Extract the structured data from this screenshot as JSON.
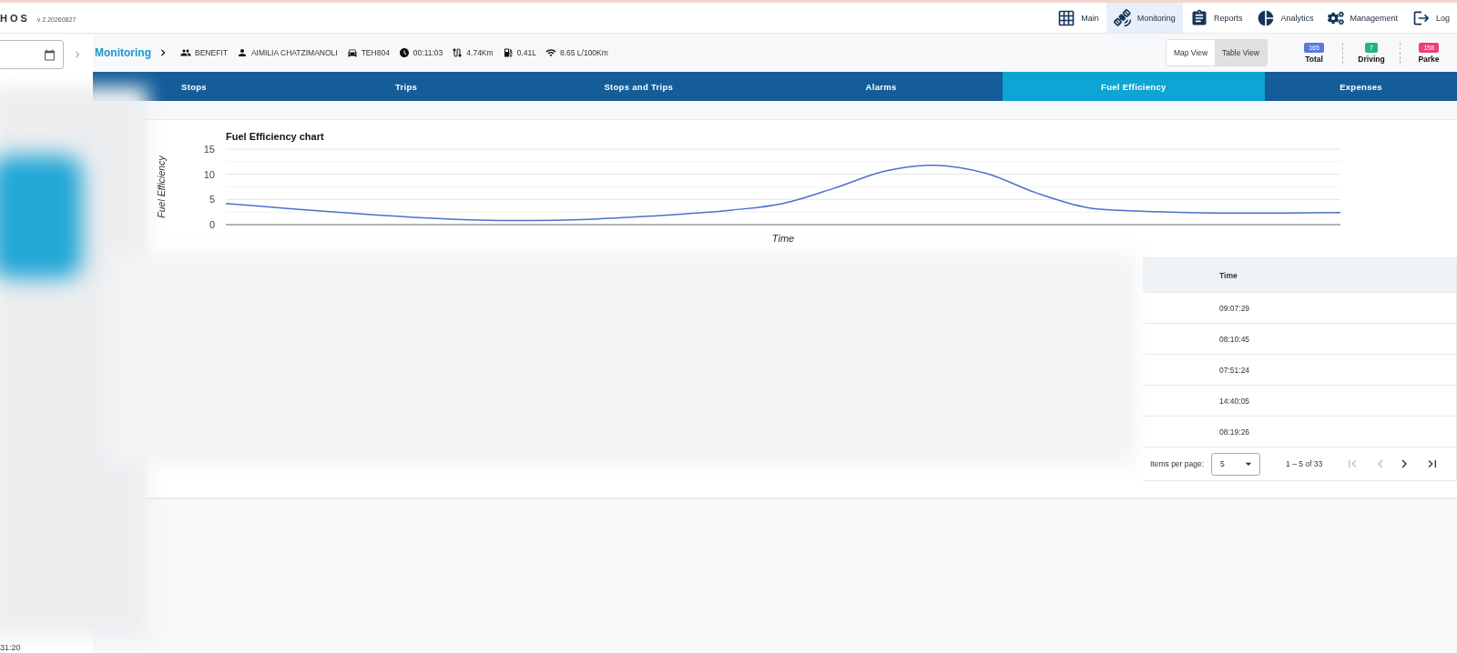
{
  "app": {
    "logo": "HOS",
    "version": "v 2.20260827"
  },
  "nav": [
    {
      "label": "Main",
      "selected": false
    },
    {
      "label": "Monitoring",
      "selected": true
    },
    {
      "label": "Reports",
      "selected": false
    },
    {
      "label": "Analytics",
      "selected": false
    },
    {
      "label": "Management",
      "selected": false
    },
    {
      "label": "Log",
      "selected": false
    }
  ],
  "sidebar": {
    "footer_time": "31:20"
  },
  "breadcrumb": {
    "title": "Monitoring",
    "items": [
      "BENEFIT",
      "AIMILIA CHATZIMANOLI",
      "TEH804",
      "00:11:03",
      "4.74Km",
      "0.41L",
      "8.65 L/100Km"
    ]
  },
  "view_toggle": [
    {
      "label": "Map View",
      "selected": false
    },
    {
      "label": "Table View",
      "selected": true
    }
  ],
  "counters": [
    {
      "count": "165",
      "label": "Total",
      "color": "#5a78e0"
    },
    {
      "count": "7",
      "label": "Driving",
      "color": "#1fb87a"
    },
    {
      "count": "158",
      "label": "Parke",
      "color": "#ee3f78"
    }
  ],
  "tabs": [
    {
      "label": "Stops",
      "selected": false
    },
    {
      "label": "Trips",
      "selected": false
    },
    {
      "label": "Stops and Trips",
      "selected": false
    },
    {
      "label": "Alarms",
      "selected": false
    },
    {
      "label": "Fuel Efficiency",
      "selected": true
    },
    {
      "label": "Expenses",
      "selected": false
    }
  ],
  "chart_data": {
    "type": "line",
    "title": "Fuel Efficiency chart",
    "xlabel": "Time",
    "ylabel": "Fuel Efficiency",
    "ylim": [
      0,
      15
    ],
    "yticks": [
      0,
      5,
      10,
      15
    ],
    "series": [
      {
        "color": "#4a72c8",
        "values": [
          4.2,
          3.4,
          2.6,
          1.9,
          1.3,
          0.9,
          0.8,
          1.0,
          1.5,
          2.1,
          2.9,
          4.2,
          7.2,
          10.6,
          11.8,
          10.2,
          6.3,
          3.4,
          2.7,
          2.4,
          2.3,
          2.3,
          2.4
        ]
      }
    ]
  },
  "table": {
    "columns": [
      "Time"
    ],
    "rows": [
      [
        "09:07:29"
      ],
      [
        "08:10:45"
      ],
      [
        "07:51:24"
      ],
      [
        "14:40:05"
      ],
      [
        "08:19:26"
      ]
    ]
  },
  "pagination": {
    "label": "Items per page:",
    "page_size": "5",
    "range": "1 – 5 of 33"
  }
}
